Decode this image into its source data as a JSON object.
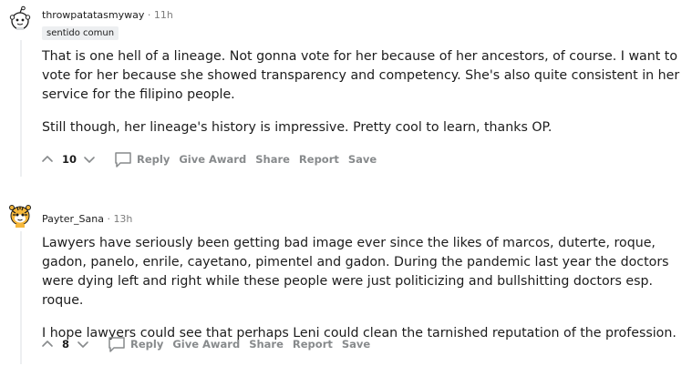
{
  "comments": [
    {
      "username": "throwpatatasmyway",
      "separator": "·",
      "time": "11h",
      "flair": "sentido comun",
      "paragraphs": [
        "That is one hell of a lineage. Not gonna vote for her because of her ancestors, of course. I want to vote for her because she showed transparency and competency. She's also quite consistent in her service for the filipino people.",
        "Still though, her lineage's history is impressive. Pretty cool to learn, thanks OP."
      ],
      "score": "10",
      "actions": {
        "reply": "Reply",
        "give_award": "Give Award",
        "share": "Share",
        "report": "Report",
        "save": "Save"
      },
      "avatar_icon": "snoo-avatar-icon"
    },
    {
      "username": "Payter_Sana",
      "separator": "·",
      "time": "13h",
      "paragraphs": [
        "Lawyers have seriously been getting bad image ever since the likes of marcos, duterte, roque, gadon, panelo, enrile, cayetano, pimentel and gadon. During the pandemic last year the doctors were dying left and right while these people were just politicizing and bullshitting doctors esp. roque.",
        "I hope lawyers could see that perhaps Leni could clean the tarnished reputation of the profession."
      ],
      "score": "8",
      "actions": {
        "reply": "Reply",
        "give_award": "Give Award",
        "share": "Share",
        "report": "Report",
        "save": "Save"
      },
      "avatar_icon": "tiger-snoo-avatar-icon"
    }
  ],
  "colors": {
    "meta_text": "#7c7c7c",
    "action_text": "#878a8c",
    "thread_line": "#edeff1",
    "flair_bg": "#edeff1",
    "body_text": "#1c1c1c"
  }
}
